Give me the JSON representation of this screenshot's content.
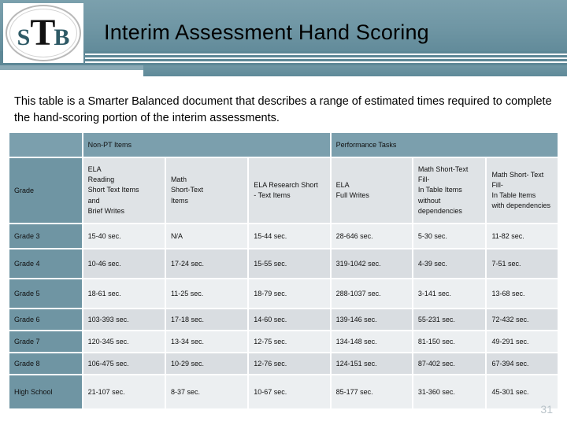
{
  "header": {
    "title": "Interim Assessment Hand Scoring",
    "logo": {
      "left": "S",
      "middle": "T",
      "right": "B"
    }
  },
  "intro": "This table is a Smarter Balanced document that describes a range of estimated times required to complete the hand-scoring portion of the interim assessments.",
  "table": {
    "group_headers": [
      {
        "label": "",
        "span": 1
      },
      {
        "label": "Non-PT Items",
        "span": 3
      },
      {
        "label": "Performance Tasks",
        "span": 3
      }
    ],
    "column_headers": [
      "Grade",
      "ELA\nReading\nShort Text Items\nand\nBrief Writes",
      "Math\nShort-Text\nItems",
      "ELA Research Short\n- Text Items",
      "ELA\nFull Writes",
      "Math Short-Text Fill-\nIn Table Items\nwithout\ndependencies",
      "Math Short- Text Fill-\nIn Table Items\nwith dependencies"
    ],
    "rows": [
      {
        "grade": "Grade 3",
        "values": [
          "15-40 sec.",
          "N/A",
          "15-44 sec.",
          "28-646 sec.",
          "5-30 sec.",
          "11-82 sec."
        ]
      },
      {
        "grade": "Grade 4",
        "values": [
          "10-46 sec.",
          "17-24 sec.",
          "15-55 sec.",
          "319-1042 sec.",
          "4-39 sec.",
          "7-51 sec."
        ]
      },
      {
        "grade": "Grade 5",
        "values": [
          "18-61 sec.",
          "11-25 sec.",
          "18-79 sec.",
          "288-1037 sec.",
          "3-141 sec.",
          "13-68 sec."
        ]
      },
      {
        "grade": "Grade 6",
        "values": [
          "103-393 sec.",
          "17-18 sec.",
          "14-60 sec.",
          "139-146 sec.",
          "55-231 sec.",
          "72-432 sec."
        ]
      },
      {
        "grade": "Grade 7",
        "values": [
          "120-345 sec.",
          "13-34 sec.",
          "12-75 sec.",
          "134-148 sec.",
          "81-150 sec.",
          "49-291 sec."
        ]
      },
      {
        "grade": "Grade 8",
        "values": [
          "106-475 sec.",
          "10-29 sec.",
          "12-76 sec.",
          "124-151 sec.",
          "87-402 sec.",
          "67-394 sec."
        ]
      },
      {
        "grade": "High School",
        "values": [
          "21-107 sec.",
          "8-37 sec.",
          "10-67 sec.",
          "85-177 sec.",
          "31-360 sec.",
          "45-301 sec."
        ]
      }
    ]
  },
  "page_number": "31",
  "colors": {
    "banner": "#6f96a4",
    "group_header": "#7b9fad",
    "row_header": "#6f95a3",
    "col_header": "#dfe3e6",
    "cell_light": "#eceff1",
    "cell_dark": "#d9dde1",
    "page_number": "#b9c3c9"
  }
}
